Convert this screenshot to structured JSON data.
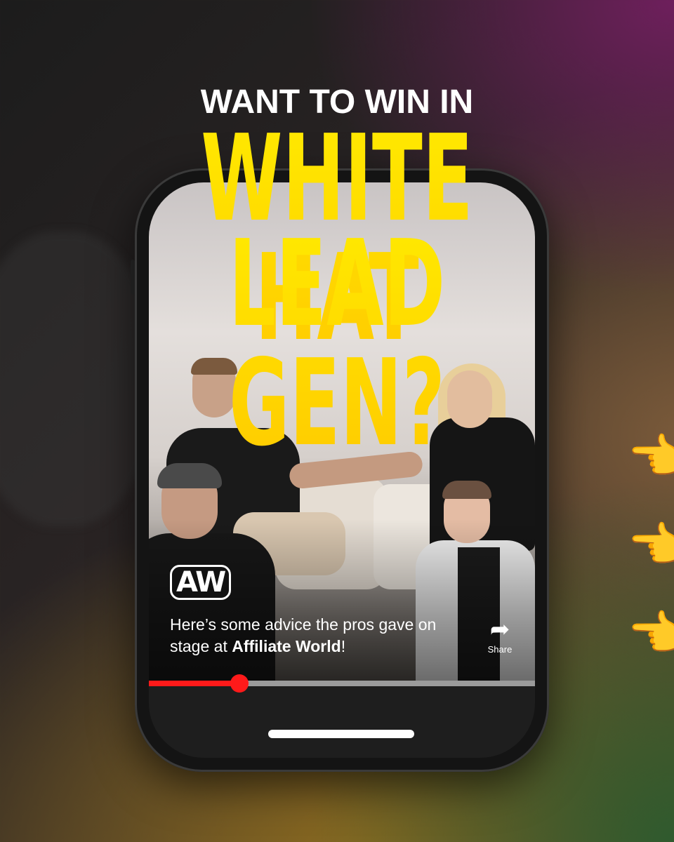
{
  "headline": {
    "small": "WANT TO WIN IN",
    "big_line1": "WHITE HAT",
    "big_line2": "LEAD GEN?"
  },
  "video": {
    "logo_text": "AW",
    "caption_plain": "Here’s some advice the pros gave on stage at ",
    "caption_bold": "Affiliate World",
    "caption_end": "!",
    "share_label": "Share",
    "progress": 0.235
  },
  "decorations": {
    "pointing_emoji": [
      "👈",
      "👈",
      "👈"
    ]
  },
  "colors": {
    "headline_yellow": "#ffe100",
    "progress_red": "#ff1a1a",
    "accent_purple": "#6e1f5c"
  },
  "icons": {
    "share": "share-arrow-icon",
    "pointer": "pointing-left-hand-icon"
  }
}
